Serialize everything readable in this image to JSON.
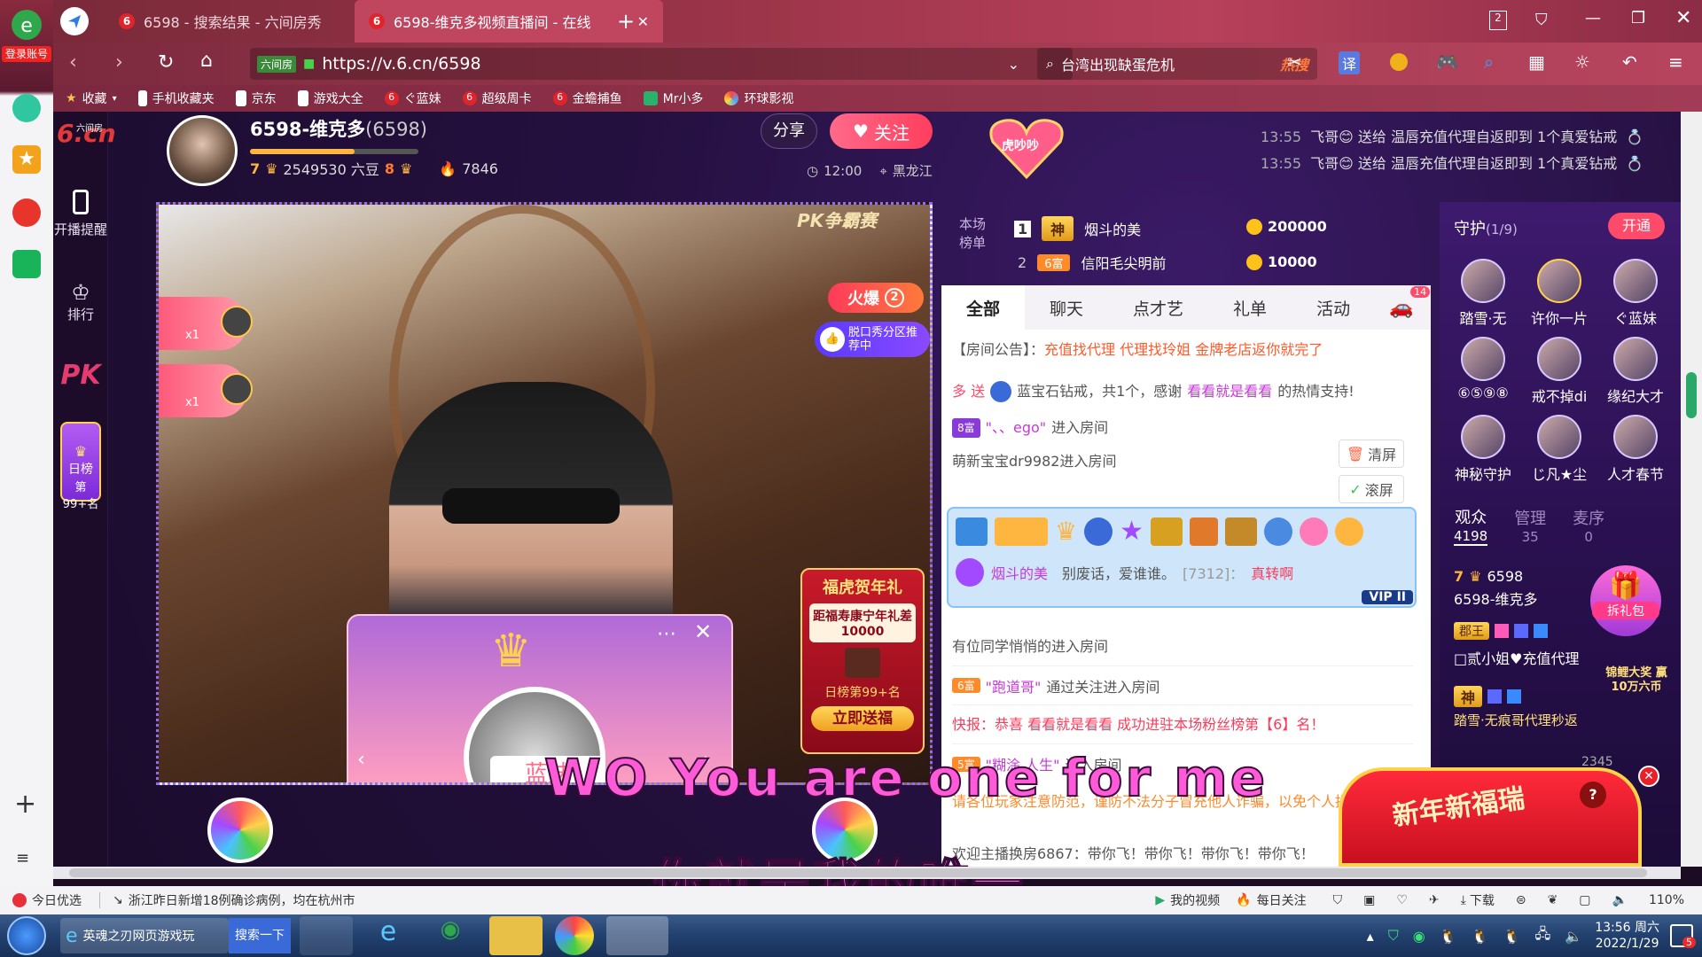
{
  "browser": {
    "login_label": "登录账号",
    "tabs": [
      {
        "label": "6598 - 搜索结果 - 六间房秀"
      },
      {
        "label": "6598-维克多视频直播间 - 在线"
      }
    ],
    "tab_count": "2",
    "url": "https://v.6.cn/6598",
    "site_badge": "六间房",
    "search_text": "台湾出现缺蛋危机",
    "search_hot": "热搜",
    "translate_label": "译",
    "bookmarks": [
      "收藏",
      "手机收藏夹",
      "京东",
      "游戏大全",
      "ぐ蓝妹",
      "超级周卡",
      "金蟾捕鱼",
      "Mr小多",
      "环球影视"
    ]
  },
  "site": {
    "logo_text": "6.cn",
    "logo_sub": "六间房",
    "nav": {
      "live_remind": "开播提醒",
      "rank": "排行",
      "pk": "PK",
      "daily_rank_title": "日榜",
      "daily_rank_pos": "第99+名"
    },
    "anchor": {
      "name": "6598-维克多",
      "room_id": "(6598)",
      "level": "7",
      "beans": "2549530 六豆",
      "fortune_level": "8",
      "popularity": "7846",
      "time": "12:00",
      "location": "黑龙江",
      "share_label": "分享",
      "follow_label": "关注"
    },
    "gift_notice": [
      {
        "time": "13:55",
        "text": "飞哥😊 送给 温唇充值代理自返即到 1个真爱钻戒"
      },
      {
        "time": "13:55",
        "text": "飞哥😊 送给 温唇充值代理自返即到 1个真爱钻戒"
      }
    ],
    "pk_badge": "虎吵吵",
    "rank_board": {
      "label": "本场榜单",
      "rows": [
        {
          "rank": "1",
          "badge": "神",
          "name": "烟斗的美",
          "score": "200000"
        },
        {
          "rank": "2",
          "badge": "6富",
          "name": "信阳毛尖明前",
          "score": "10000"
        }
      ]
    },
    "video": {
      "pk_title": "PK争霸赛",
      "hot_label": "火爆",
      "hot_count": "2",
      "talk_show_label": "脱口秀分区推荐中",
      "gift_count_1": "x1",
      "gift_count_2": "x1",
      "new_year_title": "福虎贺年礼",
      "new_year_desc": "距福寿康宁年礼差10000",
      "new_year_rank": "日榜第99+名",
      "new_year_btn": "立即送福",
      "popup_name": "蓝妹",
      "subtitle_en": "WO You are one for me",
      "subtitle_cn": "你就是我的唯一"
    },
    "chat_tabs": [
      "全部",
      "聊天",
      "点才艺",
      "礼单",
      "活动"
    ],
    "car_count": "14",
    "chat": {
      "notice_label": "【房间公告】：",
      "notice_text": "充值找代理 代理找玲姐 金牌老店返你就完了",
      "lines": [
        {
          "pre": "多 送",
          "mid": "蓝宝石钻戒，共1个，感谢",
          "name": "看看就是看看",
          "post": "的热情支持!"
        },
        {
          "badge": "8富",
          "name": "\"、、ego\"",
          "post": "进入房间"
        },
        {
          "name": "萌新宝宝dr9982",
          "post": "进入房间"
        }
      ],
      "clear_btn": "清屏",
      "scroll_btn": "滚屏",
      "vip_user": "烟斗的美",
      "vip_msg": "别废话，爱谁谁。",
      "vip_id": "[7312]：",
      "vip_tail": "真转啊",
      "vip_level": "VIP II",
      "lines2": [
        {
          "text": "有位同学悄悄的进入房间"
        },
        {
          "badge": "6富",
          "name": "\"跑道哥\"",
          "post": "通过关注进入房间"
        },
        {
          "text": "快报：恭喜 看看就是看看 成功进驻本场粉丝榜第【6】名！"
        },
        {
          "badge": "5富",
          "name": "\"糊涂 人生\"",
          "post": "进入房间"
        },
        {
          "text": "请各位玩家注意防范，谨防不法分子冒充他人诈骗，以免个人损失。"
        },
        {
          "text": "欢迎主播换房6867：带你飞！带你飞！带你飞！带你飞！"
        }
      ]
    },
    "guard": {
      "title": "守护",
      "count": "(1/9)",
      "open_btn": "开通",
      "members": [
        "踏雪·无",
        "许你一片",
        "ぐ蓝妹",
        "⑥⑤⑨⑧",
        "戒不掉di",
        "缘纪大才",
        "神秘守护",
        "じ凡★尘",
        "人才春节"
      ],
      "tabs": [
        {
          "label": "观众",
          "count": "4198"
        },
        {
          "label": "管理",
          "count": "35"
        },
        {
          "label": "麦序",
          "count": "0"
        }
      ],
      "viewer_level": "7",
      "viewer_id": "6598",
      "viewer_name": "6598-维克多",
      "gift_pack": "拆礼包",
      "viewers": [
        {
          "badge": "郡王",
          "name": "□贰小姐♥充值代理"
        },
        {
          "badge": "神",
          "name": "踏雪·无痕哥代理秒返"
        }
      ],
      "koi_label": "锦鲤大奖 赢10万六币",
      "fortune_title": "新年新福瑞",
      "count_2345": "2345"
    }
  },
  "statusbar": {
    "today": "今日优选",
    "news": "浙江昨日新增18例确诊病例，均在杭州市",
    "my_video": "我的视频",
    "daily_follow": "每日关注",
    "download": "下载",
    "zoom": "110%"
  },
  "taskbar": {
    "task1": "英魂之刃网页游戏玩",
    "search_btn": "搜索一下",
    "time": "13:56 周六",
    "date": "2022/1/29",
    "notif_count": "5"
  }
}
